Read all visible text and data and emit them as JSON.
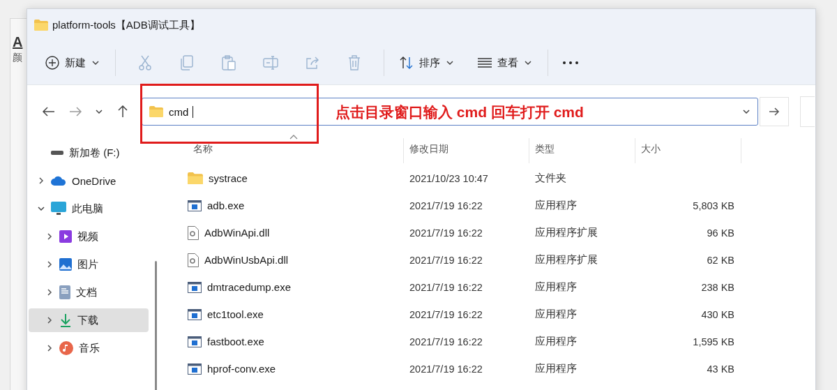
{
  "background_window": {
    "letter": "A",
    "label": "颜"
  },
  "window": {
    "title": "platform-tools【ADB调试工具】"
  },
  "toolbar": {
    "new_label": "新建",
    "sort_label": "排序",
    "view_label": "查看"
  },
  "address_bar": {
    "value": "cmd"
  },
  "annotation": {
    "text": "点击目录窗口输入 cmd 回车打开 cmd"
  },
  "sidebar": {
    "items": [
      {
        "label": "新加卷 (F:)",
        "kind": "drive",
        "selected": false
      },
      {
        "label": "OneDrive",
        "kind": "cloud",
        "expanded": false,
        "selected": false
      },
      {
        "label": "此电脑",
        "kind": "pc",
        "expanded": true,
        "selected": false,
        "children": [
          {
            "label": "视频",
            "kind": "video",
            "expanded": false,
            "selected": false
          },
          {
            "label": "图片",
            "kind": "picture",
            "expanded": false,
            "selected": false
          },
          {
            "label": "文档",
            "kind": "document",
            "expanded": false,
            "selected": false
          },
          {
            "label": "下载",
            "kind": "download",
            "expanded": false,
            "selected": true
          },
          {
            "label": "音乐",
            "kind": "music",
            "expanded": false,
            "selected": false
          }
        ]
      }
    ]
  },
  "table": {
    "columns": [
      "名称",
      "修改日期",
      "类型",
      "大小"
    ],
    "rows": [
      {
        "kind": "folder",
        "name": "systrace",
        "date": "2021/10/23 10:47",
        "type": "文件夹"
      },
      {
        "kind": "exe",
        "name": "adb.exe",
        "date": "2021/7/19 16:22",
        "type": "应用程序",
        "size": "5,803 KB"
      },
      {
        "kind": "dll",
        "name": "AdbWinApi.dll",
        "date": "2021/7/19 16:22",
        "type": "应用程序扩展",
        "size": "96 KB"
      },
      {
        "kind": "dll",
        "name": "AdbWinUsbApi.dll",
        "date": "2021/7/19 16:22",
        "type": "应用程序扩展",
        "size": "62 KB"
      },
      {
        "kind": "exe",
        "name": "dmtracedump.exe",
        "date": "2021/7/19 16:22",
        "type": "应用程序",
        "size": "238 KB"
      },
      {
        "kind": "exe",
        "name": "etc1tool.exe",
        "date": "2021/7/19 16:22",
        "type": "应用程序",
        "size": "430 KB"
      },
      {
        "kind": "exe",
        "name": "fastboot.exe",
        "date": "2021/7/19 16:22",
        "type": "应用程序",
        "size": "1,595 KB"
      },
      {
        "kind": "exe",
        "name": "hprof-conv.exe",
        "date": "2021/7/19 16:22",
        "type": "应用程序",
        "size": "43 KB"
      }
    ]
  }
}
